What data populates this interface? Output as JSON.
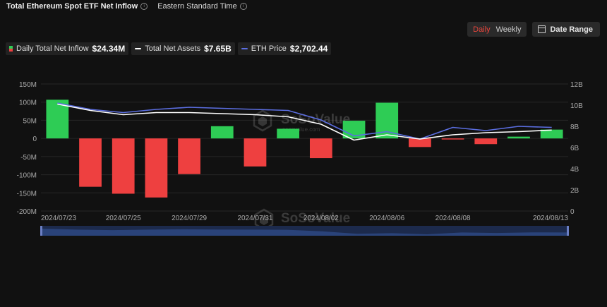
{
  "header": {
    "title": "Total Ethereum Spot ETF Net Inflow",
    "timezone": "Eastern Standard Time"
  },
  "controls": {
    "daily": "Daily",
    "weekly": "Weekly",
    "date_range": "Date Range"
  },
  "legend": [
    {
      "label": "Daily Total Net Inflow",
      "value": "$24.34M",
      "color": "#2ecc55"
    },
    {
      "label": "Total Net Assets",
      "value": "$7.65B",
      "color": "#ffffff"
    },
    {
      "label": "ETH Price",
      "value": "$2,702.44",
      "color": "#5b6ee1"
    }
  ],
  "watermark": {
    "brand": "SoSoValue",
    "url": "sosovalue.com"
  },
  "chart_data": {
    "type": "bar",
    "title": "Total Ethereum Spot ETF Net Inflow",
    "categories": [
      "2024/07/23",
      "2024/07/24",
      "2024/07/25",
      "2024/07/26",
      "2024/07/29",
      "2024/07/30",
      "2024/07/31",
      "2024/08/01",
      "2024/08/02",
      "2024/08/05",
      "2024/08/06",
      "2024/08/07",
      "2024/08/08",
      "2024/08/09",
      "2024/08/12",
      "2024/08/13"
    ],
    "x_tick_labels": [
      "2024/07/23",
      "2024/07/25",
      "2024/07/29",
      "2024/07/31",
      "2024/08/02",
      "2024/08/06",
      "2024/08/08",
      "2024/08/13"
    ],
    "series": [
      {
        "name": "Daily Total Net Inflow",
        "type": "bar",
        "axis": "left",
        "values": [
          106.6,
          -133.2,
          -152.3,
          -162.7,
          -98.3,
          33.7,
          -77.2,
          26.7,
          -54.3,
          48.8,
          98.4,
          -23.7,
          -2.9,
          -15.7,
          4.9,
          24.34
        ]
      },
      {
        "name": "Total Net Assets",
        "type": "line",
        "axis": "right",
        "values": [
          10.1,
          9.5,
          9.1,
          9.3,
          9.3,
          9.2,
          9.1,
          8.9,
          8.2,
          6.7,
          7.2,
          6.8,
          7.2,
          7.4,
          7.5,
          7.65
        ]
      },
      {
        "name": "ETH Price",
        "type": "line",
        "axis": "right",
        "values": [
          10.2,
          9.6,
          9.3,
          9.6,
          9.8,
          9.7,
          9.6,
          9.5,
          8.6,
          7.1,
          7.5,
          6.8,
          7.9,
          7.6,
          8.0,
          7.9
        ]
      }
    ],
    "y_left": {
      "ticks": [
        "150M",
        "100M",
        "50M",
        "0",
        "-50M",
        "-100M",
        "-150M",
        "-200M"
      ],
      "ylim": [
        -200,
        150
      ],
      "unit": "M"
    },
    "y_right": {
      "ticks": [
        "12B",
        "10B",
        "8B",
        "6B",
        "4B",
        "2B",
        "0"
      ],
      "ylim": [
        0,
        12
      ],
      "unit": "B"
    },
    "grid": "horizontal",
    "colors": {
      "positive": "#2ecc55",
      "negative": "#ee4040",
      "assets": "#ffffff",
      "price": "#5b6ee1"
    }
  }
}
